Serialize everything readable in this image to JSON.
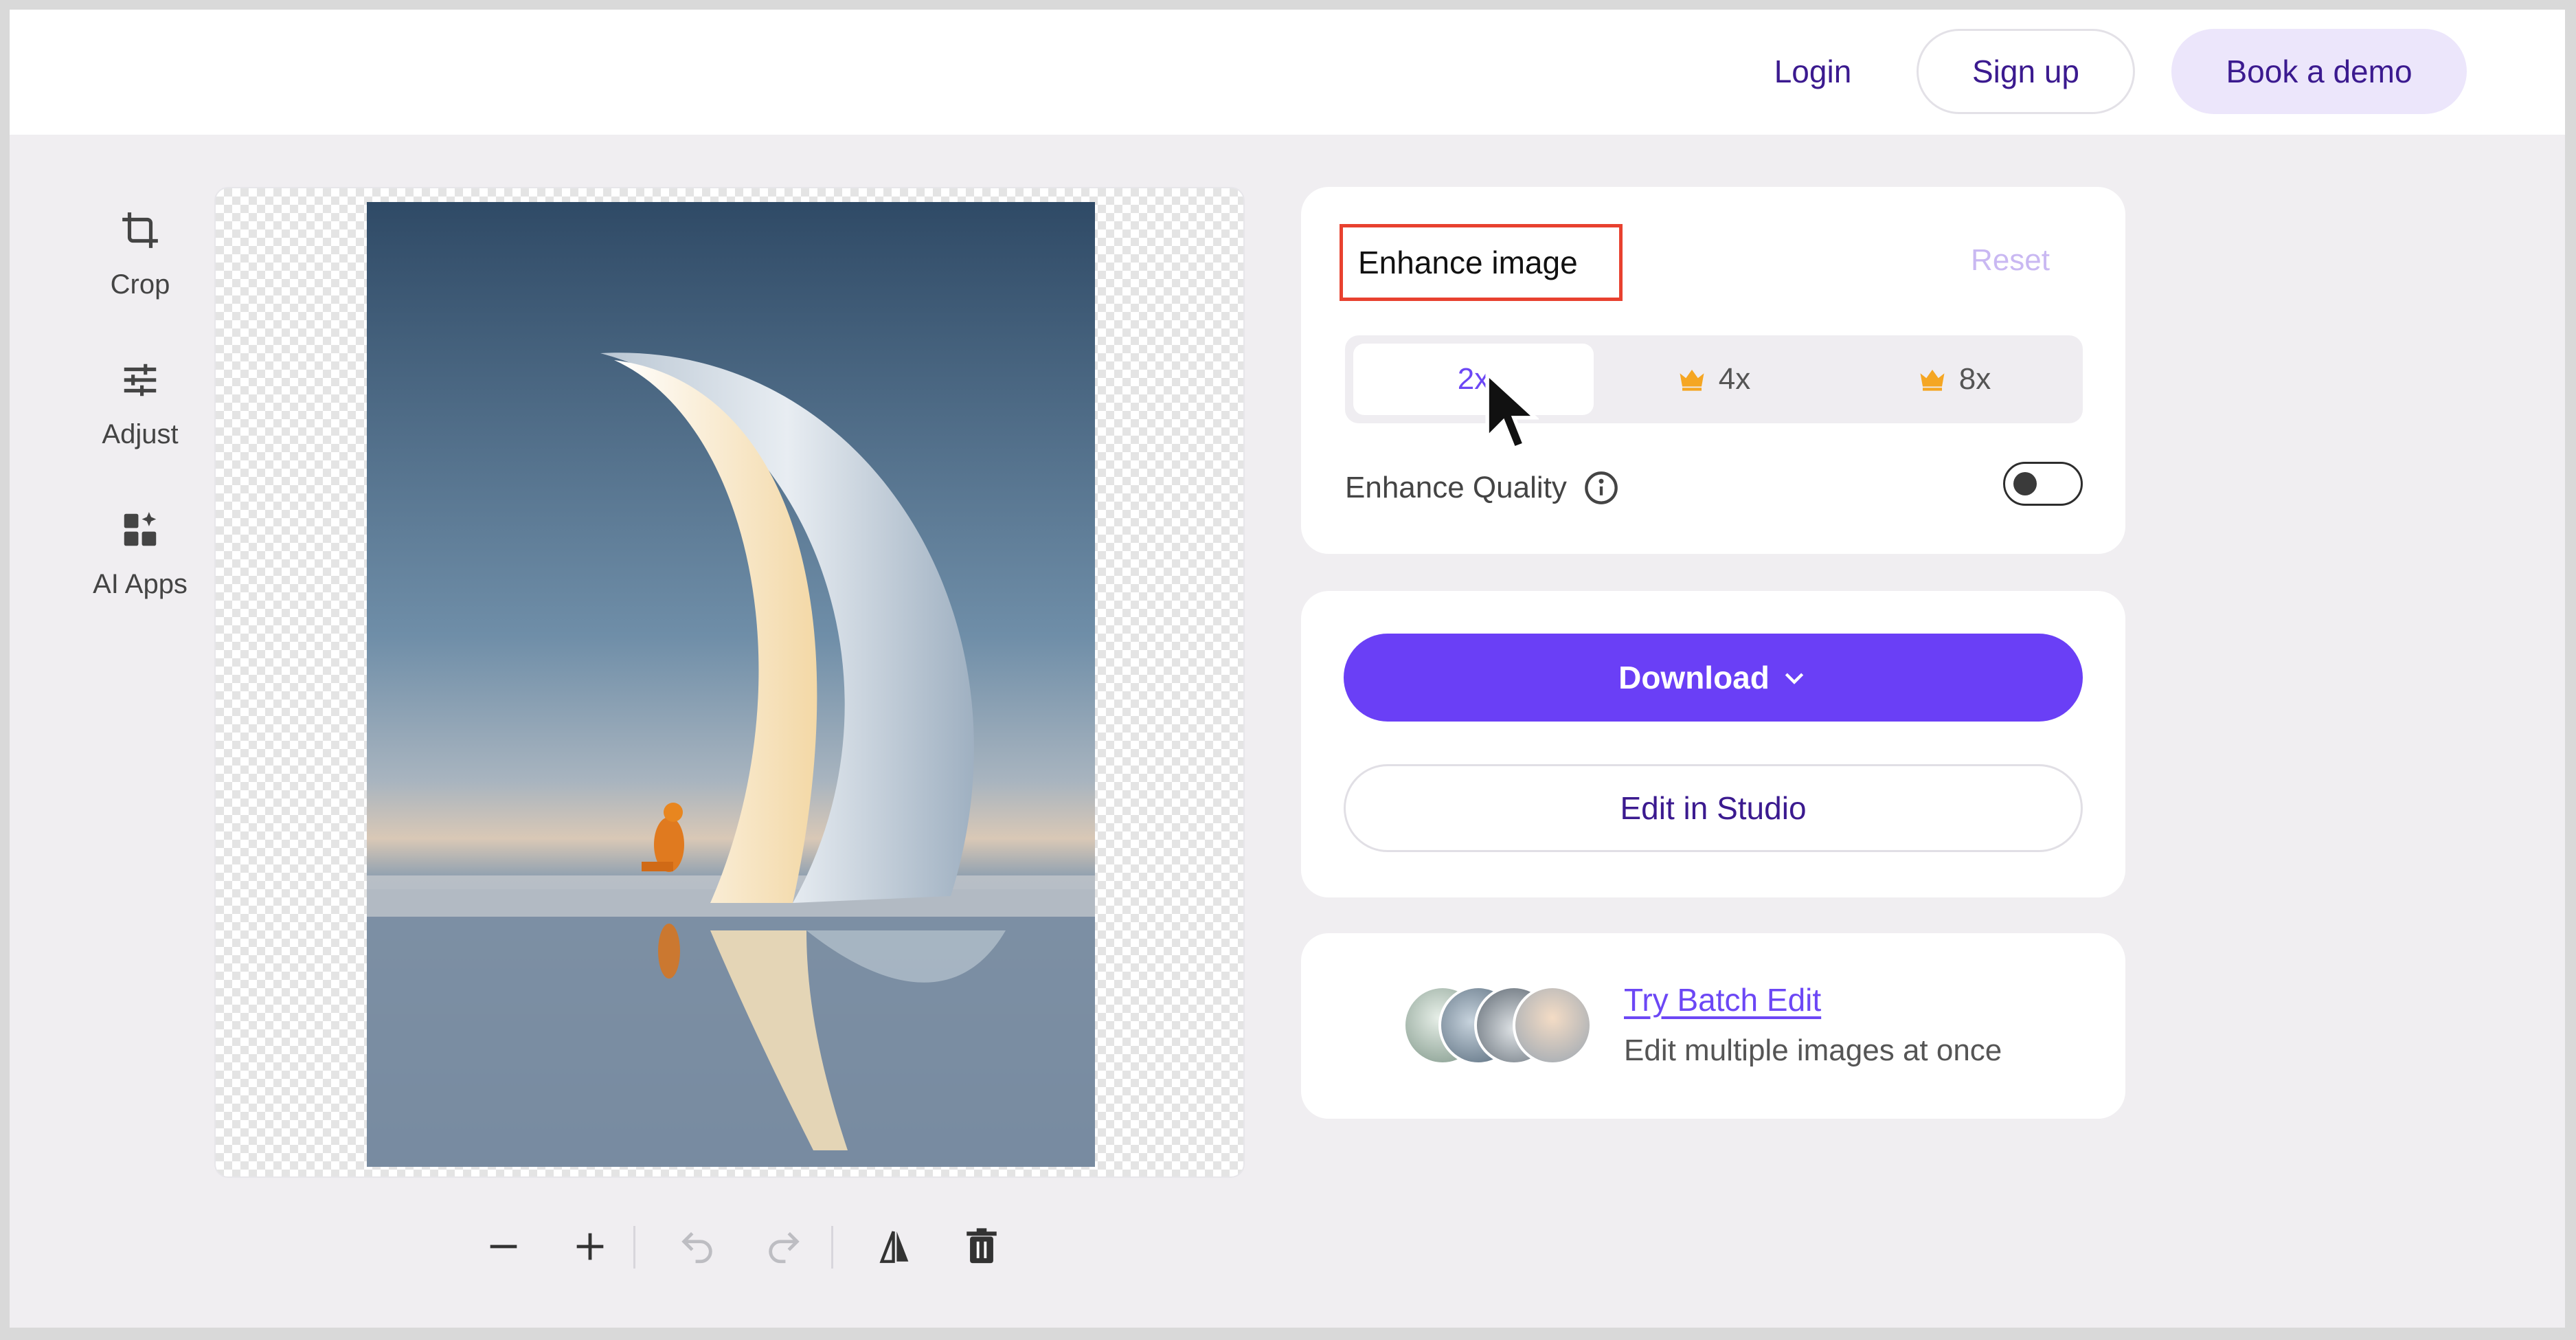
{
  "header": {
    "login_label": "Login",
    "signup_label": "Sign up",
    "demo_label": "Book a demo"
  },
  "tools": {
    "crop": "Crop",
    "adjust": "Adjust",
    "apps": "AI Apps"
  },
  "enhance": {
    "title": "Enhance image",
    "reset_label": "Reset",
    "options": [
      {
        "label": "2x",
        "premium": false,
        "selected": true
      },
      {
        "label": "4x",
        "premium": true,
        "selected": false
      },
      {
        "label": "8x",
        "premium": true,
        "selected": false
      }
    ],
    "quality_label": "Enhance Quality",
    "quality_enabled": false
  },
  "actions": {
    "download_label": "Download",
    "studio_label": "Edit in Studio"
  },
  "batch": {
    "link_label": "Try Batch Edit",
    "subtitle": "Edit multiple images at once"
  },
  "colors": {
    "accent": "#6a3ff6",
    "brand_text": "#3b1a8f",
    "highlight_border": "#e8412f",
    "crown": "#f5a623"
  }
}
